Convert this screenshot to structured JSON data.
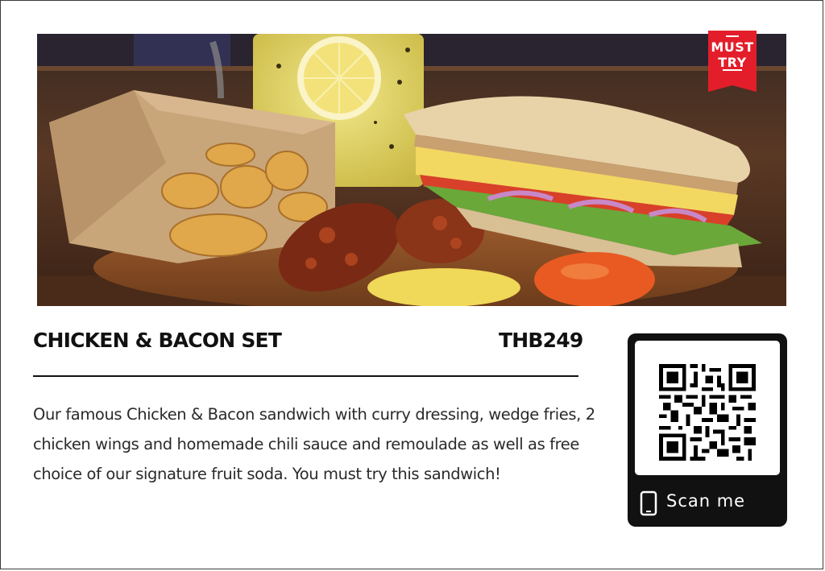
{
  "badge": {
    "line1": "MUST",
    "line2": "TRY",
    "color": "#e31e2a"
  },
  "item": {
    "title": "CHICKEN & BACON SET",
    "price": "THB249",
    "description": "Our famous Chicken & Bacon sandwich with curry dressing, wedge fries, 2 chicken wings and homemade chili sauce and remoulade as well as free choice of our signature fruit soda. You must try this sandwich!"
  },
  "qr": {
    "label": "Scan me",
    "icon": "phone-icon"
  },
  "colors": {
    "card_bg": "#ffffff",
    "qr_panel": "#111111",
    "text": "#1a1a1a"
  }
}
